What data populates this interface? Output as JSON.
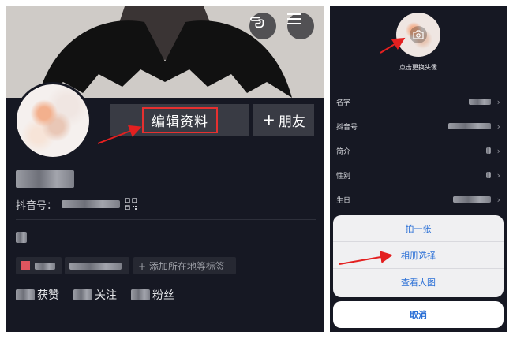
{
  "left": {
    "edit_button_label": "编辑资料",
    "friend_button_label": "朋友",
    "friend_plus": "+",
    "douyin_id_label": "抖音号：",
    "add_tag_label": "+ 添加所在地等标签",
    "stats": [
      {
        "label": "获赞"
      },
      {
        "label": "关注"
      },
      {
        "label": "粉丝"
      }
    ]
  },
  "right": {
    "change_avatar_label": "点击更换头像",
    "fields": [
      {
        "label": "名字"
      },
      {
        "label": "抖音号"
      },
      {
        "label": "简介"
      },
      {
        "label": "性别"
      },
      {
        "label": "生日"
      }
    ],
    "sheet_options": [
      {
        "label": "拍一张"
      },
      {
        "label": "相册选择"
      },
      {
        "label": "查看大图"
      }
    ],
    "cancel_label": "取消"
  },
  "colors": {
    "background": "#161823",
    "button": "#393b44",
    "highlight_box": "#e53030",
    "annotation_arrow": "#e32020",
    "sheet_text": "#2a6fd6"
  },
  "icons": [
    "hand-gesture-icon",
    "menu-icon",
    "qr-code-icon",
    "camera-icon",
    "chevron-right-icon"
  ]
}
